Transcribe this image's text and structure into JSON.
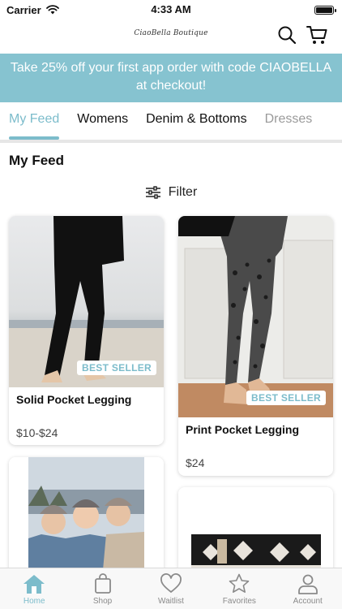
{
  "status": {
    "carrier": "Carrier",
    "time": "4:33 AM"
  },
  "header": {
    "logo_text": "CiaoBella Boutique",
    "search_icon": "search-icon",
    "cart_icon": "cart-icon"
  },
  "promo": {
    "text": "Take 25% off your first app order with code CIAOBELLA at checkout!"
  },
  "tabs": [
    {
      "label": "My Feed",
      "active": true
    },
    {
      "label": "Womens"
    },
    {
      "label": "Denim & Bottoms"
    },
    {
      "label": "Dresses"
    }
  ],
  "feed": {
    "title": "My Feed",
    "filter_label": "Filter",
    "products": [
      {
        "name": "Solid Pocket Legging",
        "price": "$10-$24",
        "badge": "BEST SELLER"
      },
      {
        "name": "Print Pocket Legging",
        "price": "$24",
        "badge": "BEST SELLER"
      }
    ]
  },
  "tabbar": [
    {
      "label": "Home",
      "icon": "home-icon",
      "active": true
    },
    {
      "label": "Shop",
      "icon": "bag-icon"
    },
    {
      "label": "Waitlist",
      "icon": "heart-icon"
    },
    {
      "label": "Favorites",
      "icon": "star-icon"
    },
    {
      "label": "Account",
      "icon": "person-icon"
    }
  ],
  "colors": {
    "accent": "#7cbccb",
    "banner": "#86c3d0"
  }
}
